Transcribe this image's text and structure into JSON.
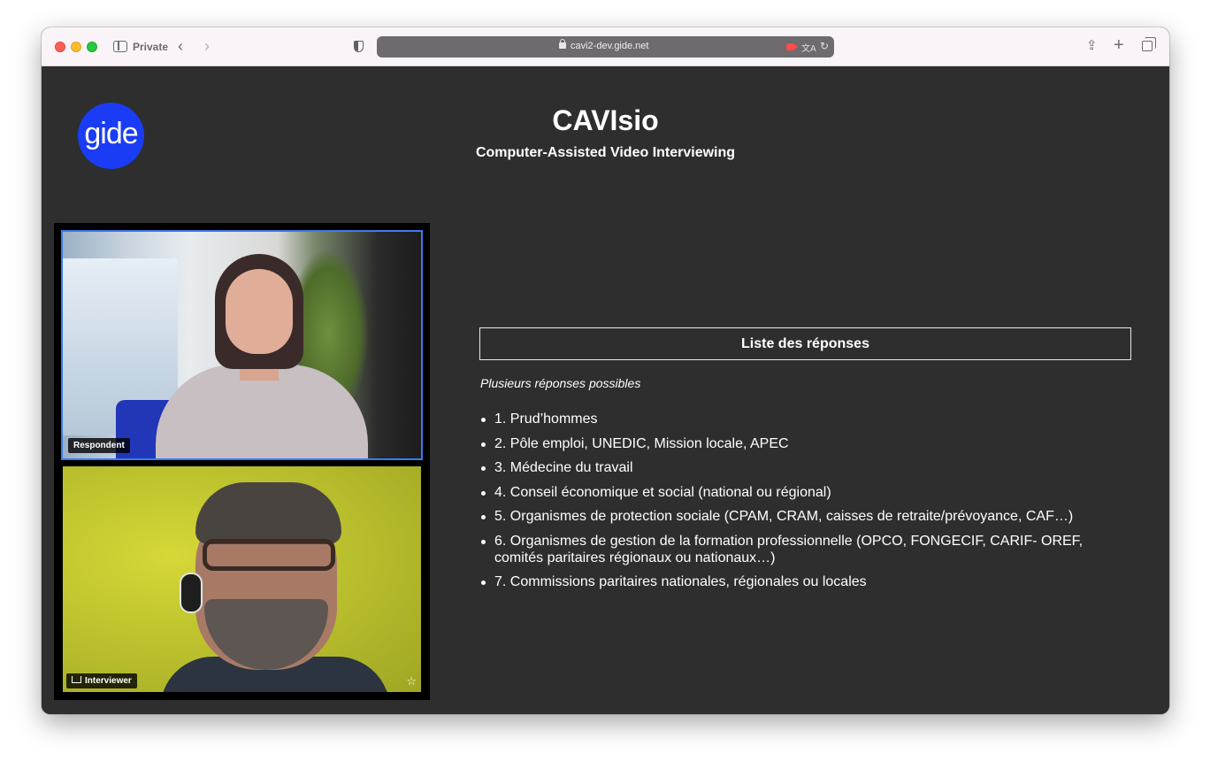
{
  "browser": {
    "private_label": "Private",
    "url": "cavi2-dev.gide.net",
    "back_glyph": "‹",
    "forward_glyph": "›",
    "newtab_glyph": "+",
    "share_glyph": "⇪",
    "reload_glyph": "↻",
    "translate_glyph": "文A"
  },
  "header": {
    "logo_text": "gide",
    "title": "CAVIsio",
    "subtitle": "Computer-Assisted Video Interviewing"
  },
  "video": {
    "respondent_label": "Respondent",
    "interviewer_label": "Interviewer",
    "star_glyph": "☆"
  },
  "answers": {
    "header": "Liste des réponses",
    "hint": "Plusieurs réponses possibles",
    "items": [
      "1. Prud’hommes",
      "2. Pôle emploi, UNEDIC, Mission locale, APEC",
      "3. Médecine du travail",
      "4. Conseil économique et social (national ou régional)",
      "5. Organismes de protection sociale (CPAM, CRAM, caisses de retraite/prévoyance, CAF…)",
      "6. Organismes de gestion de la formation professionnelle (OPCO, FONGECIF, CARIF- OREF, comités paritaires régionaux ou nationaux…)",
      "7. Commissions paritaires nationales, régionales ou locales"
    ]
  },
  "colors": {
    "page_background": "#2e2e2e",
    "logo_blue": "#1a3cf5",
    "active_tile_border": "#3a7bf0",
    "toolbar": "#faf4f8"
  }
}
